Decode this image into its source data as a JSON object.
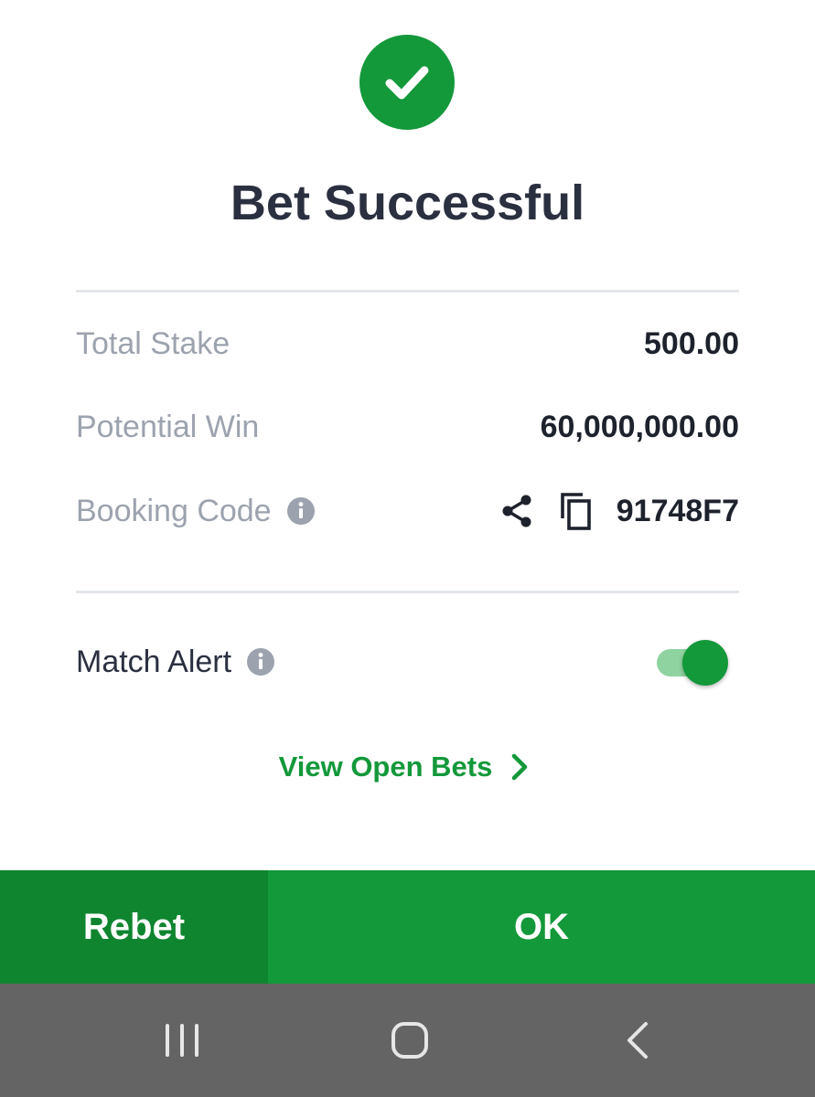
{
  "header": {
    "icon": "check-circle-icon",
    "title": "Bet Successful"
  },
  "summary": {
    "total_stake_label": "Total Stake",
    "total_stake_value": "500.00",
    "potential_win_label": "Potential Win",
    "potential_win_value": "60,000,000.00",
    "booking_code_label": "Booking Code",
    "booking_code_value": "91748F7",
    "icons": [
      "info-icon",
      "share-icon",
      "copy-icon"
    ]
  },
  "match_alert": {
    "label": "Match Alert",
    "enabled": true
  },
  "links": {
    "view_open_bets": "View Open Bets"
  },
  "buttons": {
    "rebet": "Rebet",
    "ok": "OK"
  },
  "system_nav": {
    "icons": [
      "recent-apps-icon",
      "home-icon",
      "back-icon"
    ]
  },
  "colors": {
    "accent_green": "#13983a",
    "dark_green": "#0f852f",
    "toggle_track": "#8fd3a1",
    "label_grey": "#9ca3ae",
    "title_dark": "#2b3040",
    "navbar_grey": "#646464"
  }
}
